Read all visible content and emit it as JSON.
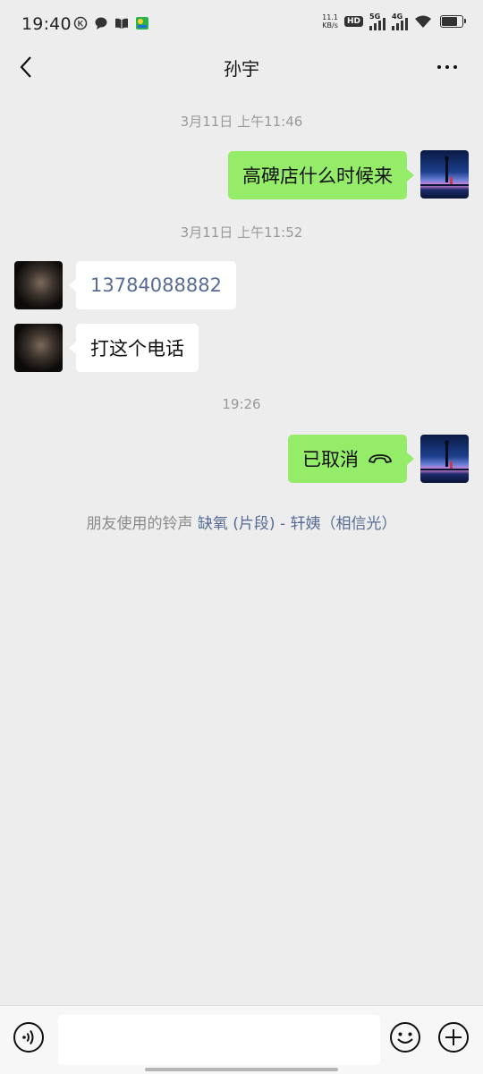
{
  "status_bar": {
    "time": "19:40",
    "net_speed_value": "11.1",
    "net_speed_unit": "KB/s",
    "hd_label": "HD",
    "sim1_gen": "5G",
    "sim2_gen": "4G",
    "battery_level": 0.85,
    "left_icons": [
      "k-app-icon",
      "chat-bubble-icon",
      "book-icon",
      "video-app-icon"
    ]
  },
  "header": {
    "title": "孙宇"
  },
  "messages": [
    {
      "type": "timestamp",
      "text": "3月11日 上午11:46"
    },
    {
      "type": "sent",
      "text": "高碑店什么时候来"
    },
    {
      "type": "timestamp",
      "text": "3月11日 上午11:52"
    },
    {
      "type": "received",
      "text": "13784088882",
      "is_link": true
    },
    {
      "type": "received",
      "text": "打这个电话"
    },
    {
      "type": "timestamp",
      "text": "19:26"
    },
    {
      "type": "sent_call",
      "text": "已取消",
      "icon": "hangup-phone-icon"
    }
  ],
  "ringtone": {
    "prefix": "朋友使用的铃声",
    "song": "缺氧 (片段) - 轩姨（相信光）"
  },
  "input_bar": {
    "voice_icon": "voice-icon",
    "emoji_icon": "emoji-icon",
    "plus_icon": "plus-icon",
    "placeholder": ""
  },
  "colors": {
    "background": "#ededed",
    "sent_bubble": "#95ec69",
    "received_bubble": "#ffffff",
    "link": "#576b95"
  }
}
